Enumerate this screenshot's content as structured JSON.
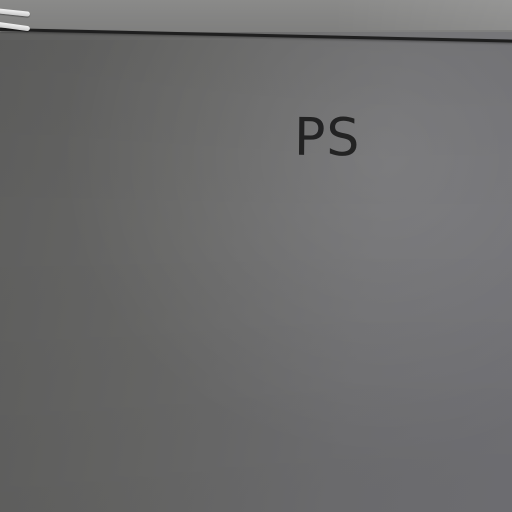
{
  "photo": {
    "label_text": "PS"
  }
}
